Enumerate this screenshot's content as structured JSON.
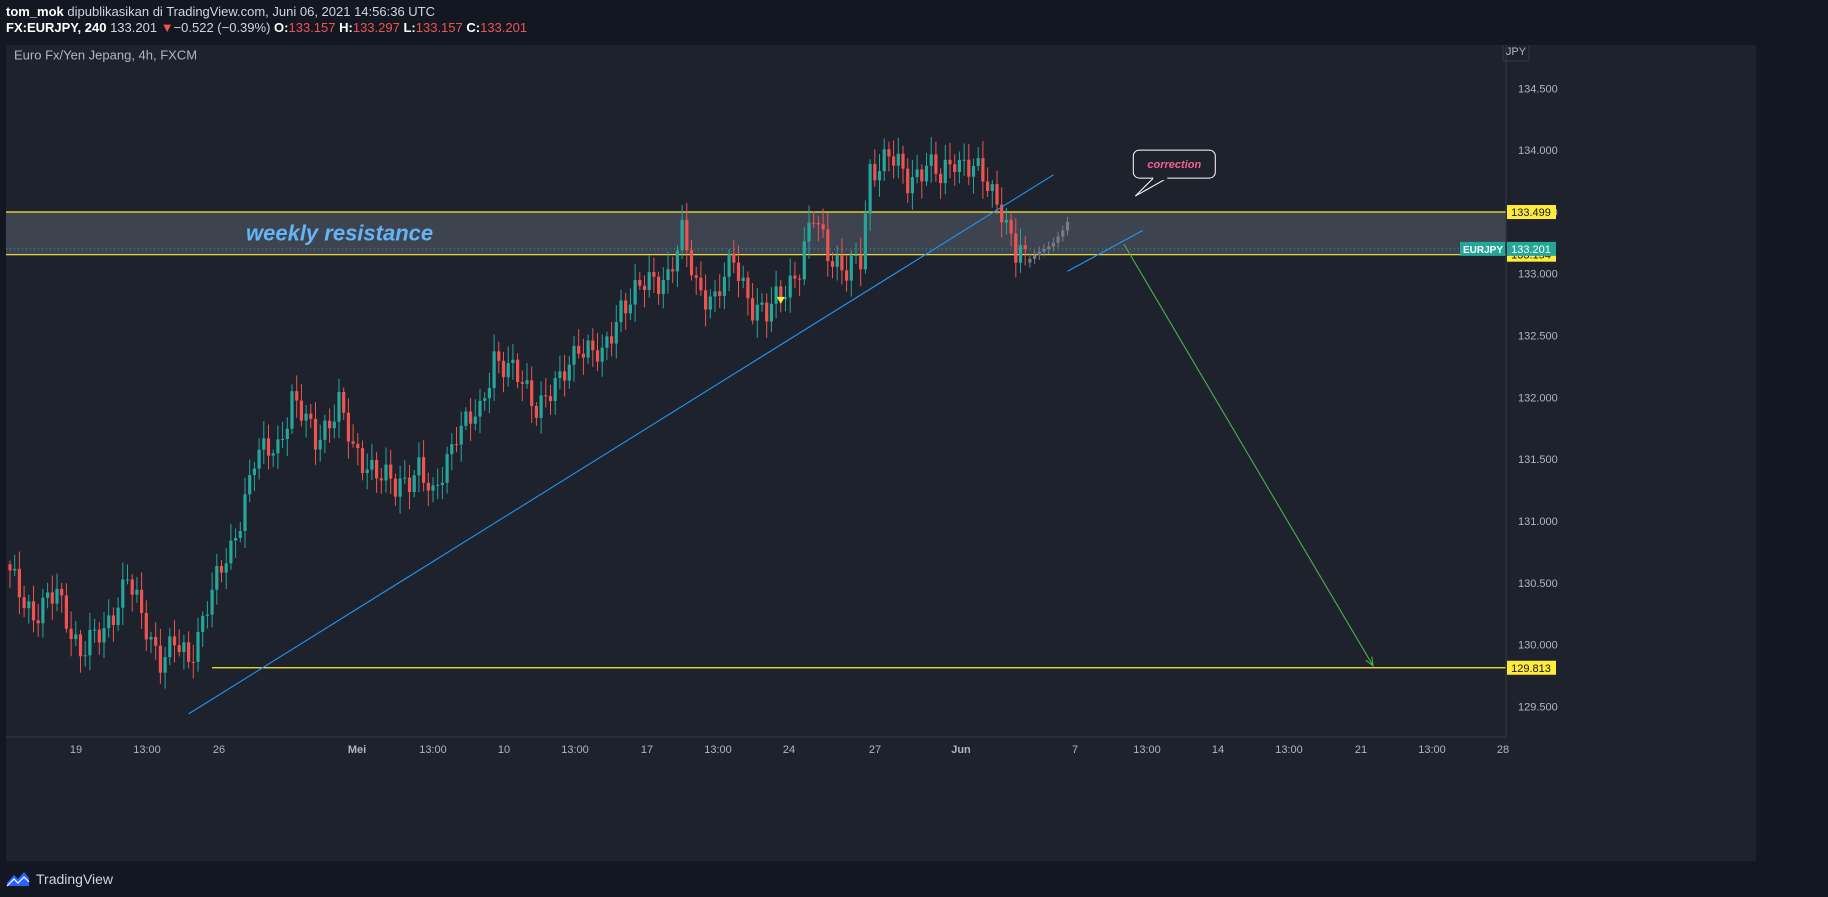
{
  "header": {
    "author": "tom_mok",
    "published_text": "dipublikasikan di TradingView.com, Juni 06, 2021 14:56:36 UTC",
    "symbol": "FX:EURJPY, 240",
    "last": "133.201",
    "change_arrow": "▼",
    "change": "−0.522 (−0.39%)",
    "o_label": "O:",
    "o_value": "133.157",
    "h_label": "H:",
    "h_value": "133.297",
    "l_label": "L:",
    "l_value": "133.157",
    "c_label": "C:",
    "c_value": "133.201"
  },
  "footer": {
    "brand": "TradingView"
  },
  "colors": {
    "background": "#131722",
    "chart_bg": "#1e222d",
    "up": "#26a69a",
    "down": "#ef5350",
    "projection": "#787b86",
    "trendline": "#2196f3",
    "level": "#ffeb3b",
    "arrow": "#4caf50",
    "zone_fill": "#4a4f5c",
    "annotation": "#64b5f6",
    "callout_text": "#f06292"
  },
  "chart_data": {
    "type": "candlestick",
    "title": "Euro Fx/Yen Jepang, 4h, FXCM",
    "currency_label": "JPY",
    "y_range": [
      129.35,
      134.85
    ],
    "y_ticks": [
      "134.500",
      "134.000",
      "133.500",
      "133.000",
      "132.500",
      "132.000",
      "131.500",
      "131.000",
      "130.500",
      "130.000",
      "129.500"
    ],
    "x_tick_labels": [
      {
        "label": "19",
        "bold": false
      },
      {
        "label": "13:00",
        "bold": false
      },
      {
        "label": "26",
        "bold": false
      },
      {
        "label": "Mei",
        "bold": true
      },
      {
        "label": "13:00",
        "bold": false
      },
      {
        "label": "10",
        "bold": false
      },
      {
        "label": "13:00",
        "bold": false
      },
      {
        "label": "17",
        "bold": false
      },
      {
        "label": "13:00",
        "bold": false
      },
      {
        "label": "24",
        "bold": false
      },
      {
        "label": "27",
        "bold": false
      },
      {
        "label": "Jun",
        "bold": true
      },
      {
        "label": "7",
        "bold": false
      },
      {
        "label": "13:00",
        "bold": false
      },
      {
        "label": "14",
        "bold": false
      },
      {
        "label": "13:00",
        "bold": false
      },
      {
        "label": "21",
        "bold": false
      },
      {
        "label": "13:00",
        "bold": false
      },
      {
        "label": "28",
        "bold": false
      }
    ],
    "waypoints": [
      {
        "i": 0,
        "p": 130.55
      },
      {
        "i": 5,
        "p": 130.25
      },
      {
        "i": 10,
        "p": 130.4
      },
      {
        "i": 15,
        "p": 129.95
      },
      {
        "i": 20,
        "p": 130.1
      },
      {
        "i": 25,
        "p": 130.55
      },
      {
        "i": 28,
        "p": 130.2
      },
      {
        "i": 32,
        "p": 129.9
      },
      {
        "i": 35,
        "p": 130.0
      },
      {
        "i": 38,
        "p": 129.85
      },
      {
        "i": 42,
        "p": 130.35
      },
      {
        "i": 47,
        "p": 130.75
      },
      {
        "i": 52,
        "p": 131.5
      },
      {
        "i": 57,
        "p": 131.6
      },
      {
        "i": 60,
        "p": 132.0
      },
      {
        "i": 65,
        "p": 131.65
      },
      {
        "i": 70,
        "p": 131.95
      },
      {
        "i": 73,
        "p": 131.55
      },
      {
        "i": 77,
        "p": 131.45
      },
      {
        "i": 82,
        "p": 131.25
      },
      {
        "i": 87,
        "p": 131.45
      },
      {
        "i": 90,
        "p": 131.15
      },
      {
        "i": 95,
        "p": 131.75
      },
      {
        "i": 100,
        "p": 131.85
      },
      {
        "i": 103,
        "p": 132.35
      },
      {
        "i": 108,
        "p": 132.15
      },
      {
        "i": 112,
        "p": 131.95
      },
      {
        "i": 117,
        "p": 132.1
      },
      {
        "i": 121,
        "p": 132.45
      },
      {
        "i": 126,
        "p": 132.3
      },
      {
        "i": 130,
        "p": 132.75
      },
      {
        "i": 135,
        "p": 132.9
      },
      {
        "i": 140,
        "p": 133.0
      },
      {
        "i": 143,
        "p": 133.3
      },
      {
        "i": 146,
        "p": 132.9
      },
      {
        "i": 150,
        "p": 132.8
      },
      {
        "i": 154,
        "p": 133.1
      },
      {
        "i": 158,
        "p": 132.75
      },
      {
        "i": 161,
        "p": 132.65
      },
      {
        "i": 164,
        "p": 132.85
      },
      {
        "i": 168,
        "p": 133.05
      },
      {
        "i": 171,
        "p": 133.45
      },
      {
        "i": 174,
        "p": 133.2
      },
      {
        "i": 178,
        "p": 133.0
      },
      {
        "i": 181,
        "p": 133.1
      },
      {
        "i": 183,
        "p": 133.85
      },
      {
        "i": 187,
        "p": 133.95
      },
      {
        "i": 191,
        "p": 133.75
      },
      {
        "i": 195,
        "p": 133.9
      },
      {
        "i": 198,
        "p": 133.75
      },
      {
        "i": 201,
        "p": 133.95
      },
      {
        "i": 205,
        "p": 133.85
      },
      {
        "i": 208,
        "p": 133.7
      },
      {
        "i": 211,
        "p": 133.55
      },
      {
        "i": 214,
        "p": 133.15
      },
      {
        "i": 216,
        "p": 133.2
      }
    ],
    "projection": [
      133.12,
      133.15,
      133.18,
      133.2,
      133.22,
      133.25,
      133.3,
      133.35,
      133.42
    ],
    "resistance_zone": {
      "top": 133.499,
      "bottom": 133.154,
      "label": "weekly resistance"
    },
    "target_level": {
      "value": 129.813
    },
    "last_price": {
      "value": 133.201,
      "symbol": "EURJPY"
    },
    "price_tags": [
      {
        "value": 133.499,
        "label": "133.499"
      },
      {
        "value": 133.154,
        "label": "133.154"
      },
      {
        "value": 129.813,
        "label": "129.813"
      }
    ],
    "callout": {
      "text": "correction"
    }
  }
}
